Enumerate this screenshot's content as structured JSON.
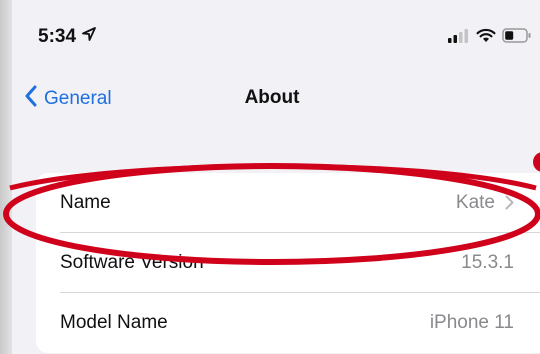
{
  "status_bar": {
    "time": "5:34",
    "location_icon": "location-arrow-icon",
    "signal_icon": "cellular-signal-icon",
    "wifi_icon": "wifi-icon",
    "battery_icon": "battery-icon"
  },
  "nav": {
    "back_label": "General",
    "back_icon": "chevron-left-icon",
    "title": "About"
  },
  "rows": [
    {
      "label": "Name",
      "value": "Kate",
      "has_chevron": true
    },
    {
      "label": "Software Version",
      "value": "15.3.1",
      "has_chevron": false
    },
    {
      "label": "Model Name",
      "value": "iPhone 11",
      "has_chevron": false
    }
  ],
  "colors": {
    "accent": "#1f6fe0",
    "annotation": "#d0021b",
    "background": "#f1f1f6"
  }
}
